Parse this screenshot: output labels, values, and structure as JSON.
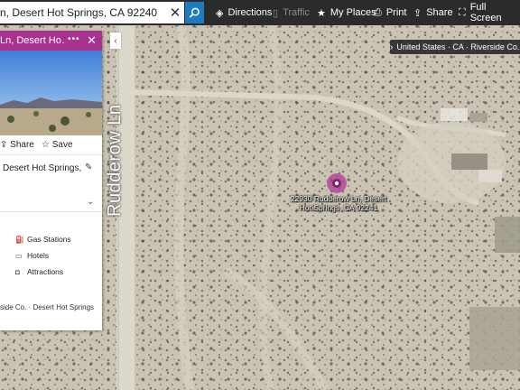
{
  "search": {
    "value": "n, Desert Hot Springs, CA 92240"
  },
  "toolbar": {
    "directions": "Directions",
    "traffic": "Traffic",
    "my_places": "My Places",
    "print": "Print",
    "share": "Share",
    "full_screen": "Full Screen"
  },
  "breadcrumb": {
    "text": "United States · CA · Riverside Co. · De"
  },
  "panel": {
    "title": "Ln, Desert Ho…",
    "share": "Share",
    "save": "Save",
    "address": "Desert Hot Springs,",
    "nearby": [
      "Gas Stations",
      "Hotels",
      "Attractions"
    ],
    "footer": "side Co. · Desert Hot Springs"
  },
  "map": {
    "road_label": "Rudderow Ln",
    "pin_label_line1": "22930 Rudderow Ln, Desert",
    "pin_label_line2": "Hot Springs, CA 92241",
    "pin_color": "#b23a9a"
  },
  "colors": {
    "accent": "#a7328f",
    "search_button": "#1c7cbf",
    "toolbar": "#2b2b2b"
  }
}
